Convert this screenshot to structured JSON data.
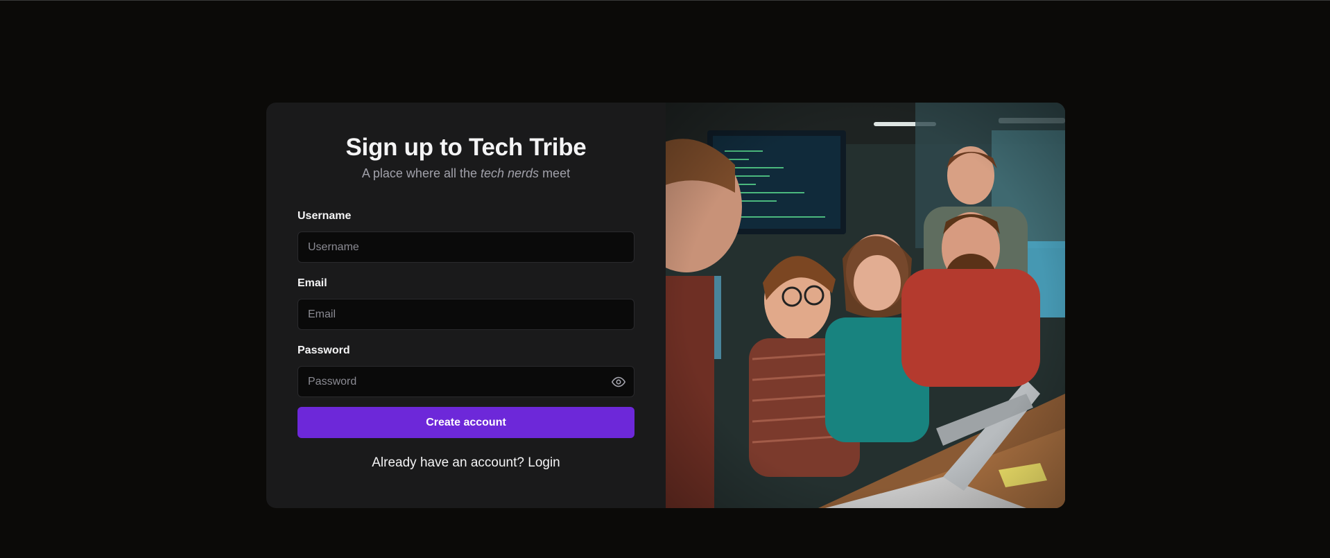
{
  "signup": {
    "title": "Sign up to Tech Tribe",
    "subtitle_before": "A place where all the ",
    "subtitle_emphasis": "tech nerds",
    "subtitle_after": " meet",
    "fields": {
      "username": {
        "label": "Username",
        "placeholder": "Username",
        "value": ""
      },
      "email": {
        "label": "Email",
        "placeholder": "Email",
        "value": ""
      },
      "password": {
        "label": "Password",
        "placeholder": "Password",
        "value": "",
        "toggle_icon": "eye-icon"
      }
    },
    "submit_label": "Create account",
    "login_prompt": "Already have an account? ",
    "login_link": "Login"
  },
  "hero_image": {
    "subject": "group of smiling developers at laptops and monitors"
  },
  "colors": {
    "page_bg": "#0b0a08",
    "card_bg": "#1a1a1b",
    "input_bg": "#0a0a0a",
    "accent": "#6d28d9",
    "text": "#f4f4f5",
    "muted": "#a1a1aa"
  }
}
